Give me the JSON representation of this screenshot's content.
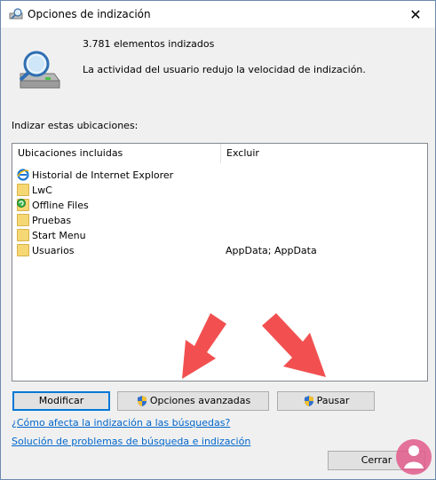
{
  "window": {
    "title": "Opciones de indización",
    "close_glyph": "✕"
  },
  "summary": {
    "count_text": "3.781 elementos indizados",
    "status_text": "La actividad del usuario redujo la velocidad de indización."
  },
  "locations": {
    "label": "Indizar estas ubicaciones:",
    "headers": {
      "included": "Ubicaciones incluidas",
      "exclude": "Excluir"
    },
    "rows": [
      {
        "name": "Historial de Internet Explorer",
        "exclude": "",
        "icon": "ie-icon"
      },
      {
        "name": "LwC",
        "exclude": "",
        "icon": "folder-icon"
      },
      {
        "name": "Offline Files",
        "exclude": "",
        "icon": "sync-icon"
      },
      {
        "name": "Pruebas",
        "exclude": "",
        "icon": "folder-icon"
      },
      {
        "name": "Start Menu",
        "exclude": "",
        "icon": "folder-icon"
      },
      {
        "name": "Usuarios",
        "exclude": "AppData; AppData",
        "icon": "folder-icon"
      }
    ]
  },
  "buttons": {
    "modify": "Modificar",
    "advanced": "Opciones avanzadas",
    "pause": "Pausar",
    "close": "Cerrar"
  },
  "links": {
    "how": "¿Cómo afecta la indización a las búsquedas?",
    "troubleshoot": "Solución de problemas de búsqueda e indización"
  },
  "colors": {
    "accent": "#0078d7",
    "link": "#0066cc",
    "arrow": "#f25050"
  }
}
